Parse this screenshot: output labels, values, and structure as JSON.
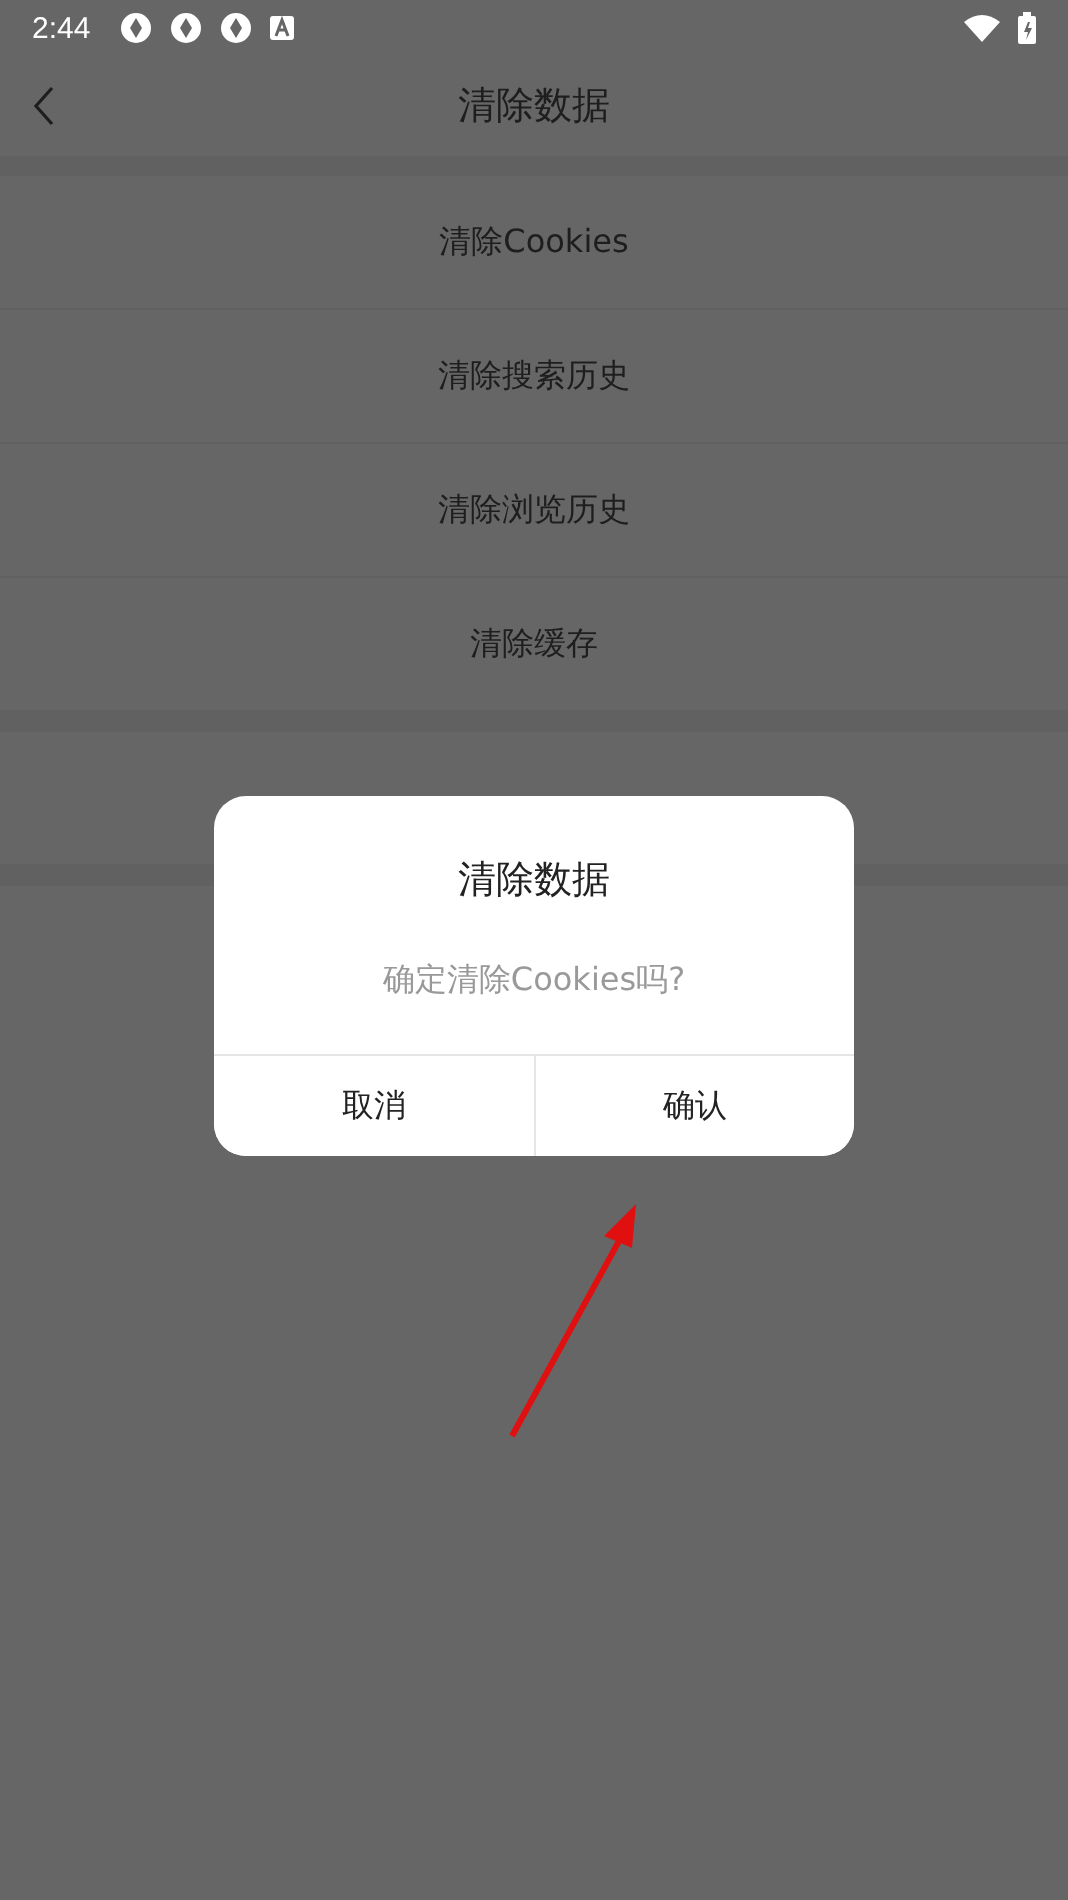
{
  "status_bar": {
    "time": "2:44"
  },
  "header": {
    "title": "清除数据"
  },
  "groups": [
    {
      "items": [
        "清除Cookies",
        "清除搜索历史",
        "清除浏览历史",
        "清除缓存"
      ]
    }
  ],
  "dialog": {
    "title": "清除数据",
    "message": "确定清除Cookies吗?",
    "buttons": [
      "取消",
      "确认"
    ]
  }
}
